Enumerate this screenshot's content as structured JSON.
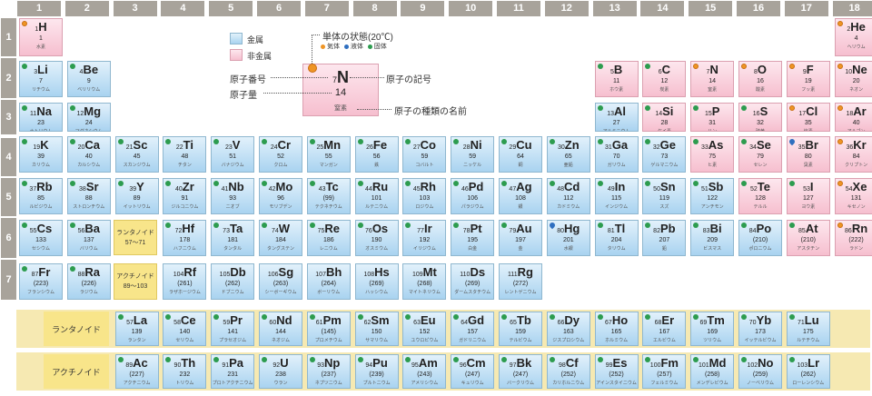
{
  "group_headers": [
    "1",
    "2",
    "3",
    "4",
    "5",
    "6",
    "7",
    "8",
    "9",
    "10",
    "11",
    "12",
    "13",
    "14",
    "15",
    "16",
    "17",
    "18"
  ],
  "period_headers": [
    "1",
    "2",
    "3",
    "4",
    "5",
    "6",
    "7"
  ],
  "elements": [
    {
      "z": "1",
      "s": "H",
      "m": "1",
      "n": "水素",
      "g": 1,
      "p": 1,
      "t": "non",
      "st": "gas"
    },
    {
      "z": "2",
      "s": "He",
      "m": "4",
      "n": "ヘリウム",
      "g": 18,
      "p": 1,
      "t": "non",
      "st": "gas"
    },
    {
      "z": "3",
      "s": "Li",
      "m": "7",
      "n": "リチウム",
      "g": 1,
      "p": 2,
      "t": "met",
      "st": "solid"
    },
    {
      "z": "4",
      "s": "Be",
      "m": "9",
      "n": "ベリリウム",
      "g": 2,
      "p": 2,
      "t": "met",
      "st": "solid"
    },
    {
      "z": "5",
      "s": "B",
      "m": "11",
      "n": "ホウ素",
      "g": 13,
      "p": 2,
      "t": "non",
      "st": "solid"
    },
    {
      "z": "6",
      "s": "C",
      "m": "12",
      "n": "炭素",
      "g": 14,
      "p": 2,
      "t": "non",
      "st": "solid"
    },
    {
      "z": "7",
      "s": "N",
      "m": "14",
      "n": "窒素",
      "g": 15,
      "p": 2,
      "t": "non",
      "st": "gas"
    },
    {
      "z": "8",
      "s": "O",
      "m": "16",
      "n": "酸素",
      "g": 16,
      "p": 2,
      "t": "non",
      "st": "gas"
    },
    {
      "z": "9",
      "s": "F",
      "m": "19",
      "n": "フッ素",
      "g": 17,
      "p": 2,
      "t": "non",
      "st": "gas"
    },
    {
      "z": "10",
      "s": "Ne",
      "m": "20",
      "n": "ネオン",
      "g": 18,
      "p": 2,
      "t": "non",
      "st": "gas"
    },
    {
      "z": "11",
      "s": "Na",
      "m": "23",
      "n": "ナトリウム",
      "g": 1,
      "p": 3,
      "t": "met",
      "st": "solid"
    },
    {
      "z": "12",
      "s": "Mg",
      "m": "24",
      "n": "マグネシウム",
      "g": 2,
      "p": 3,
      "t": "met",
      "st": "solid"
    },
    {
      "z": "13",
      "s": "Al",
      "m": "27",
      "n": "アルミニウム",
      "g": 13,
      "p": 3,
      "t": "met",
      "st": "solid"
    },
    {
      "z": "14",
      "s": "Si",
      "m": "28",
      "n": "ケイ素",
      "g": 14,
      "p": 3,
      "t": "non",
      "st": "solid"
    },
    {
      "z": "15",
      "s": "P",
      "m": "31",
      "n": "リン",
      "g": 15,
      "p": 3,
      "t": "non",
      "st": "solid"
    },
    {
      "z": "16",
      "s": "S",
      "m": "32",
      "n": "硫黄",
      "g": 16,
      "p": 3,
      "t": "non",
      "st": "solid"
    },
    {
      "z": "17",
      "s": "Cl",
      "m": "35",
      "n": "塩素",
      "g": 17,
      "p": 3,
      "t": "non",
      "st": "gas"
    },
    {
      "z": "18",
      "s": "Ar",
      "m": "40",
      "n": "アルゴン",
      "g": 18,
      "p": 3,
      "t": "non",
      "st": "gas"
    },
    {
      "z": "19",
      "s": "K",
      "m": "39",
      "n": "カリウム",
      "g": 1,
      "p": 4,
      "t": "met",
      "st": "solid"
    },
    {
      "z": "20",
      "s": "Ca",
      "m": "40",
      "n": "カルシウム",
      "g": 2,
      "p": 4,
      "t": "met",
      "st": "solid"
    },
    {
      "z": "21",
      "s": "Sc",
      "m": "45",
      "n": "スカンジウム",
      "g": 3,
      "p": 4,
      "t": "met",
      "st": "solid"
    },
    {
      "z": "22",
      "s": "Ti",
      "m": "48",
      "n": "チタン",
      "g": 4,
      "p": 4,
      "t": "met",
      "st": "solid"
    },
    {
      "z": "23",
      "s": "V",
      "m": "51",
      "n": "バナジウム",
      "g": 5,
      "p": 4,
      "t": "met",
      "st": "solid"
    },
    {
      "z": "24",
      "s": "Cr",
      "m": "52",
      "n": "クロム",
      "g": 6,
      "p": 4,
      "t": "met",
      "st": "solid"
    },
    {
      "z": "25",
      "s": "Mn",
      "m": "55",
      "n": "マンガン",
      "g": 7,
      "p": 4,
      "t": "met",
      "st": "solid"
    },
    {
      "z": "26",
      "s": "Fe",
      "m": "56",
      "n": "鉄",
      "g": 8,
      "p": 4,
      "t": "met",
      "st": "solid"
    },
    {
      "z": "27",
      "s": "Co",
      "m": "59",
      "n": "コバルト",
      "g": 9,
      "p": 4,
      "t": "met",
      "st": "solid"
    },
    {
      "z": "28",
      "s": "Ni",
      "m": "59",
      "n": "ニッケル",
      "g": 10,
      "p": 4,
      "t": "met",
      "st": "solid"
    },
    {
      "z": "29",
      "s": "Cu",
      "m": "64",
      "n": "銅",
      "g": 11,
      "p": 4,
      "t": "met",
      "st": "solid"
    },
    {
      "z": "30",
      "s": "Zn",
      "m": "65",
      "n": "亜鉛",
      "g": 12,
      "p": 4,
      "t": "met",
      "st": "solid"
    },
    {
      "z": "31",
      "s": "Ga",
      "m": "70",
      "n": "ガリウム",
      "g": 13,
      "p": 4,
      "t": "met",
      "st": "solid"
    },
    {
      "z": "32",
      "s": "Ge",
      "m": "73",
      "n": "ゲルマニウム",
      "g": 14,
      "p": 4,
      "t": "met",
      "st": "solid"
    },
    {
      "z": "33",
      "s": "As",
      "m": "75",
      "n": "ヒ素",
      "g": 15,
      "p": 4,
      "t": "non",
      "st": "solid"
    },
    {
      "z": "34",
      "s": "Se",
      "m": "79",
      "n": "セレン",
      "g": 16,
      "p": 4,
      "t": "non",
      "st": "solid"
    },
    {
      "z": "35",
      "s": "Br",
      "m": "80",
      "n": "臭素",
      "g": 17,
      "p": 4,
      "t": "non",
      "st": "liquid"
    },
    {
      "z": "36",
      "s": "Kr",
      "m": "84",
      "n": "クリプトン",
      "g": 18,
      "p": 4,
      "t": "non",
      "st": "gas"
    },
    {
      "z": "37",
      "s": "Rb",
      "m": "85",
      "n": "ルビジウム",
      "g": 1,
      "p": 5,
      "t": "met",
      "st": "solid"
    },
    {
      "z": "38",
      "s": "Sr",
      "m": "88",
      "n": "ストロンチウム",
      "g": 2,
      "p": 5,
      "t": "met",
      "st": "solid"
    },
    {
      "z": "39",
      "s": "Y",
      "m": "89",
      "n": "イットリウム",
      "g": 3,
      "p": 5,
      "t": "met",
      "st": "solid"
    },
    {
      "z": "40",
      "s": "Zr",
      "m": "91",
      "n": "ジルコニウム",
      "g": 4,
      "p": 5,
      "t": "met",
      "st": "solid"
    },
    {
      "z": "41",
      "s": "Nb",
      "m": "93",
      "n": "ニオブ",
      "g": 5,
      "p": 5,
      "t": "met",
      "st": "solid"
    },
    {
      "z": "42",
      "s": "Mo",
      "m": "96",
      "n": "モリブデン",
      "g": 6,
      "p": 5,
      "t": "met",
      "st": "solid"
    },
    {
      "z": "43",
      "s": "Tc",
      "m": "(99)",
      "n": "テクネチウム",
      "g": 7,
      "p": 5,
      "t": "met",
      "st": "solid"
    },
    {
      "z": "44",
      "s": "Ru",
      "m": "101",
      "n": "ルテニウム",
      "g": 8,
      "p": 5,
      "t": "met",
      "st": "solid"
    },
    {
      "z": "45",
      "s": "Rh",
      "m": "103",
      "n": "ロジウム",
      "g": 9,
      "p": 5,
      "t": "met",
      "st": "solid"
    },
    {
      "z": "46",
      "s": "Pd",
      "m": "106",
      "n": "パラジウム",
      "g": 10,
      "p": 5,
      "t": "met",
      "st": "solid"
    },
    {
      "z": "47",
      "s": "Ag",
      "m": "108",
      "n": "銀",
      "g": 11,
      "p": 5,
      "t": "met",
      "st": "solid"
    },
    {
      "z": "48",
      "s": "Cd",
      "m": "112",
      "n": "カドミウム",
      "g": 12,
      "p": 5,
      "t": "met",
      "st": "solid"
    },
    {
      "z": "49",
      "s": "In",
      "m": "115",
      "n": "インジウム",
      "g": 13,
      "p": 5,
      "t": "met",
      "st": "solid"
    },
    {
      "z": "50",
      "s": "Sn",
      "m": "119",
      "n": "スズ",
      "g": 14,
      "p": 5,
      "t": "met",
      "st": "solid"
    },
    {
      "z": "51",
      "s": "Sb",
      "m": "122",
      "n": "アンチモン",
      "g": 15,
      "p": 5,
      "t": "met",
      "st": "solid"
    },
    {
      "z": "52",
      "s": "Te",
      "m": "128",
      "n": "テルル",
      "g": 16,
      "p": 5,
      "t": "non",
      "st": "solid"
    },
    {
      "z": "53",
      "s": "I",
      "m": "127",
      "n": "ヨウ素",
      "g": 17,
      "p": 5,
      "t": "non",
      "st": "solid"
    },
    {
      "z": "54",
      "s": "Xe",
      "m": "131",
      "n": "キセノン",
      "g": 18,
      "p": 5,
      "t": "non",
      "st": "gas"
    },
    {
      "z": "55",
      "s": "Cs",
      "m": "133",
      "n": "セシウム",
      "g": 1,
      "p": 6,
      "t": "met",
      "st": "solid"
    },
    {
      "z": "56",
      "s": "Ba",
      "m": "137",
      "n": "バリウム",
      "g": 2,
      "p": 6,
      "t": "met",
      "st": "solid"
    },
    {
      "z": "72",
      "s": "Hf",
      "m": "178",
      "n": "ハフニウム",
      "g": 4,
      "p": 6,
      "t": "met",
      "st": "solid"
    },
    {
      "z": "73",
      "s": "Ta",
      "m": "181",
      "n": "タンタル",
      "g": 5,
      "p": 6,
      "t": "met",
      "st": "solid"
    },
    {
      "z": "74",
      "s": "W",
      "m": "184",
      "n": "タングステン",
      "g": 6,
      "p": 6,
      "t": "met",
      "st": "solid"
    },
    {
      "z": "75",
      "s": "Re",
      "m": "186",
      "n": "レニウム",
      "g": 7,
      "p": 6,
      "t": "met",
      "st": "solid"
    },
    {
      "z": "76",
      "s": "Os",
      "m": "190",
      "n": "オスミウム",
      "g": 8,
      "p": 6,
      "t": "met",
      "st": "solid"
    },
    {
      "z": "77",
      "s": "Ir",
      "m": "192",
      "n": "イリジウム",
      "g": 9,
      "p": 6,
      "t": "met",
      "st": "solid"
    },
    {
      "z": "78",
      "s": "Pt",
      "m": "195",
      "n": "白金",
      "g": 10,
      "p": 6,
      "t": "met",
      "st": "solid"
    },
    {
      "z": "79",
      "s": "Au",
      "m": "197",
      "n": "金",
      "g": 11,
      "p": 6,
      "t": "met",
      "st": "solid"
    },
    {
      "z": "80",
      "s": "Hg",
      "m": "201",
      "n": "水銀",
      "g": 12,
      "p": 6,
      "t": "met",
      "st": "liquid"
    },
    {
      "z": "81",
      "s": "Tl",
      "m": "204",
      "n": "タリウム",
      "g": 13,
      "p": 6,
      "t": "met",
      "st": "solid"
    },
    {
      "z": "82",
      "s": "Pb",
      "m": "207",
      "n": "鉛",
      "g": 14,
      "p": 6,
      "t": "met",
      "st": "solid"
    },
    {
      "z": "83",
      "s": "Bi",
      "m": "209",
      "n": "ビスマス",
      "g": 15,
      "p": 6,
      "t": "met",
      "st": "solid"
    },
    {
      "z": "84",
      "s": "Po",
      "m": "(210)",
      "n": "ポロニウム",
      "g": 16,
      "p": 6,
      "t": "met",
      "st": "solid"
    },
    {
      "z": "85",
      "s": "At",
      "m": "(210)",
      "n": "アスタチン",
      "g": 17,
      "p": 6,
      "t": "non",
      "st": "solid"
    },
    {
      "z": "86",
      "s": "Rn",
      "m": "(222)",
      "n": "ラドン",
      "g": 18,
      "p": 6,
      "t": "non",
      "st": "gas"
    },
    {
      "z": "87",
      "s": "Fr",
      "m": "(223)",
      "n": "フランシウム",
      "g": 1,
      "p": 7,
      "t": "met",
      "st": "solid"
    },
    {
      "z": "88",
      "s": "Ra",
      "m": "(226)",
      "n": "ラジウム",
      "g": 2,
      "p": 7,
      "t": "met",
      "st": "solid"
    },
    {
      "z": "104",
      "s": "Rf",
      "m": "(261)",
      "n": "ラザホージウム",
      "g": 4,
      "p": 7,
      "t": "met",
      "st": ""
    },
    {
      "z": "105",
      "s": "Db",
      "m": "(262)",
      "n": "ドブニウム",
      "g": 5,
      "p": 7,
      "t": "met",
      "st": ""
    },
    {
      "z": "106",
      "s": "Sg",
      "m": "(263)",
      "n": "シーボーギウム",
      "g": 6,
      "p": 7,
      "t": "met",
      "st": ""
    },
    {
      "z": "107",
      "s": "Bh",
      "m": "(264)",
      "n": "ボーリウム",
      "g": 7,
      "p": 7,
      "t": "met",
      "st": ""
    },
    {
      "z": "108",
      "s": "Hs",
      "m": "(269)",
      "n": "ハッシウム",
      "g": 8,
      "p": 7,
      "t": "met",
      "st": ""
    },
    {
      "z": "109",
      "s": "Mt",
      "m": "(268)",
      "n": "マイトネリウム",
      "g": 9,
      "p": 7,
      "t": "met",
      "st": ""
    },
    {
      "z": "110",
      "s": "Ds",
      "m": "(269)",
      "n": "ダームスタチウム",
      "g": 10,
      "p": 7,
      "t": "met",
      "st": ""
    },
    {
      "z": "111",
      "s": "Rg",
      "m": "(272)",
      "n": "レントゲニウム",
      "g": 11,
      "p": 7,
      "t": "met",
      "st": ""
    },
    {
      "z": "57",
      "s": "La",
      "m": "139",
      "n": "ランタン",
      "g": 3,
      "p": 8,
      "t": "met",
      "st": "solid"
    },
    {
      "z": "58",
      "s": "Ce",
      "m": "140",
      "n": "セリウム",
      "g": 4,
      "p": 8,
      "t": "met",
      "st": "solid"
    },
    {
      "z": "59",
      "s": "Pr",
      "m": "141",
      "n": "プラセオジム",
      "g": 5,
      "p": 8,
      "t": "met",
      "st": "solid"
    },
    {
      "z": "60",
      "s": "Nd",
      "m": "144",
      "n": "ネオジム",
      "g": 6,
      "p": 8,
      "t": "met",
      "st": "solid"
    },
    {
      "z": "61",
      "s": "Pm",
      "m": "(145)",
      "n": "プロメチウム",
      "g": 7,
      "p": 8,
      "t": "met",
      "st": "solid"
    },
    {
      "z": "62",
      "s": "Sm",
      "m": "150",
      "n": "サマリウム",
      "g": 8,
      "p": 8,
      "t": "met",
      "st": "solid"
    },
    {
      "z": "63",
      "s": "Eu",
      "m": "152",
      "n": "ユウロピウム",
      "g": 9,
      "p": 8,
      "t": "met",
      "st": "solid"
    },
    {
      "z": "64",
      "s": "Gd",
      "m": "157",
      "n": "ガドリニウム",
      "g": 10,
      "p": 8,
      "t": "met",
      "st": "solid"
    },
    {
      "z": "65",
      "s": "Tb",
      "m": "159",
      "n": "テルビウム",
      "g": 11,
      "p": 8,
      "t": "met",
      "st": "solid"
    },
    {
      "z": "66",
      "s": "Dy",
      "m": "163",
      "n": "ジスプロシウム",
      "g": 12,
      "p": 8,
      "t": "met",
      "st": "solid"
    },
    {
      "z": "67",
      "s": "Ho",
      "m": "165",
      "n": "ホルミウム",
      "g": 13,
      "p": 8,
      "t": "met",
      "st": "solid"
    },
    {
      "z": "68",
      "s": "Er",
      "m": "167",
      "n": "エルビウム",
      "g": 14,
      "p": 8,
      "t": "met",
      "st": "solid"
    },
    {
      "z": "69",
      "s": "Tm",
      "m": "169",
      "n": "ツリウム",
      "g": 15,
      "p": 8,
      "t": "met",
      "st": "solid"
    },
    {
      "z": "70",
      "s": "Yb",
      "m": "173",
      "n": "イッテルビウム",
      "g": 16,
      "p": 8,
      "t": "met",
      "st": "solid"
    },
    {
      "z": "71",
      "s": "Lu",
      "m": "175",
      "n": "ルテチウム",
      "g": 17,
      "p": 8,
      "t": "met",
      "st": "solid"
    },
    {
      "z": "89",
      "s": "Ac",
      "m": "(227)",
      "n": "アクチニウム",
      "g": 3,
      "p": 9,
      "t": "met",
      "st": "solid"
    },
    {
      "z": "90",
      "s": "Th",
      "m": "232",
      "n": "トリウム",
      "g": 4,
      "p": 9,
      "t": "met",
      "st": "solid"
    },
    {
      "z": "91",
      "s": "Pa",
      "m": "231",
      "n": "プロトアクチニウム",
      "g": 5,
      "p": 9,
      "t": "met",
      "st": "solid"
    },
    {
      "z": "92",
      "s": "U",
      "m": "238",
      "n": "ウラン",
      "g": 6,
      "p": 9,
      "t": "met",
      "st": "solid"
    },
    {
      "z": "93",
      "s": "Np",
      "m": "(237)",
      "n": "ネプツニウム",
      "g": 7,
      "p": 9,
      "t": "met",
      "st": "solid"
    },
    {
      "z": "94",
      "s": "Pu",
      "m": "(239)",
      "n": "プルトニウム",
      "g": 8,
      "p": 9,
      "t": "met",
      "st": "solid"
    },
    {
      "z": "95",
      "s": "Am",
      "m": "(243)",
      "n": "アメリシウム",
      "g": 9,
      "p": 9,
      "t": "met",
      "st": "solid"
    },
    {
      "z": "96",
      "s": "Cm",
      "m": "(247)",
      "n": "キュリウム",
      "g": 10,
      "p": 9,
      "t": "met",
      "st": "solid"
    },
    {
      "z": "97",
      "s": "Bk",
      "m": "(247)",
      "n": "バークリウム",
      "g": 11,
      "p": 9,
      "t": "met",
      "st": "solid"
    },
    {
      "z": "98",
      "s": "Cf",
      "m": "(252)",
      "n": "カリホルニウム",
      "g": 12,
      "p": 9,
      "t": "met",
      "st": "solid"
    },
    {
      "z": "99",
      "s": "Es",
      "m": "(252)",
      "n": "アインスタイニウム",
      "g": 13,
      "p": 9,
      "t": "met",
      "st": "solid"
    },
    {
      "z": "100",
      "s": "Fm",
      "m": "(257)",
      "n": "フェルミウム",
      "g": 14,
      "p": 9,
      "t": "met",
      "st": "solid"
    },
    {
      "z": "101",
      "s": "Md",
      "m": "(258)",
      "n": "メンデレビウム",
      "g": 15,
      "p": 9,
      "t": "met",
      "st": "solid"
    },
    {
      "z": "102",
      "s": "No",
      "m": "(259)",
      "n": "ノーベリウム",
      "g": 16,
      "p": 9,
      "t": "met",
      "st": "solid"
    },
    {
      "z": "103",
      "s": "Lr",
      "m": "(262)",
      "n": "ローレンシウム",
      "g": 17,
      "p": 9,
      "t": "met",
      "st": "solid"
    }
  ],
  "placeholders": {
    "lanthanoid": {
      "label": "ランタノイド",
      "range": "57～71"
    },
    "actinoid": {
      "label": "アクチノイド",
      "range": "89～103"
    }
  },
  "series_labels": {
    "lanthanoid": "ランタノイド",
    "actinoid": "アクチノイド"
  },
  "legend": {
    "metal": "金属",
    "nonmetal": "非金属",
    "state_title": "単体の状態(20℃)",
    "gas": "気体",
    "liquid": "液体",
    "solid": "固体",
    "atomic_number": "原子番号",
    "atomic_mass": "原子量",
    "symbol": "原子の記号",
    "name": "原子の種類の名前"
  },
  "sample": {
    "z": "7",
    "s": "N",
    "m": "14",
    "n": "窒素"
  },
  "colors": {
    "metal": "#a9d3f0",
    "nonmetal": "#f6bfcf",
    "solid": "#2d9c4f",
    "gas": "#ef9525",
    "liquid": "#2f6fc0",
    "header": "#a8a39b",
    "note": "#f8e58a"
  }
}
